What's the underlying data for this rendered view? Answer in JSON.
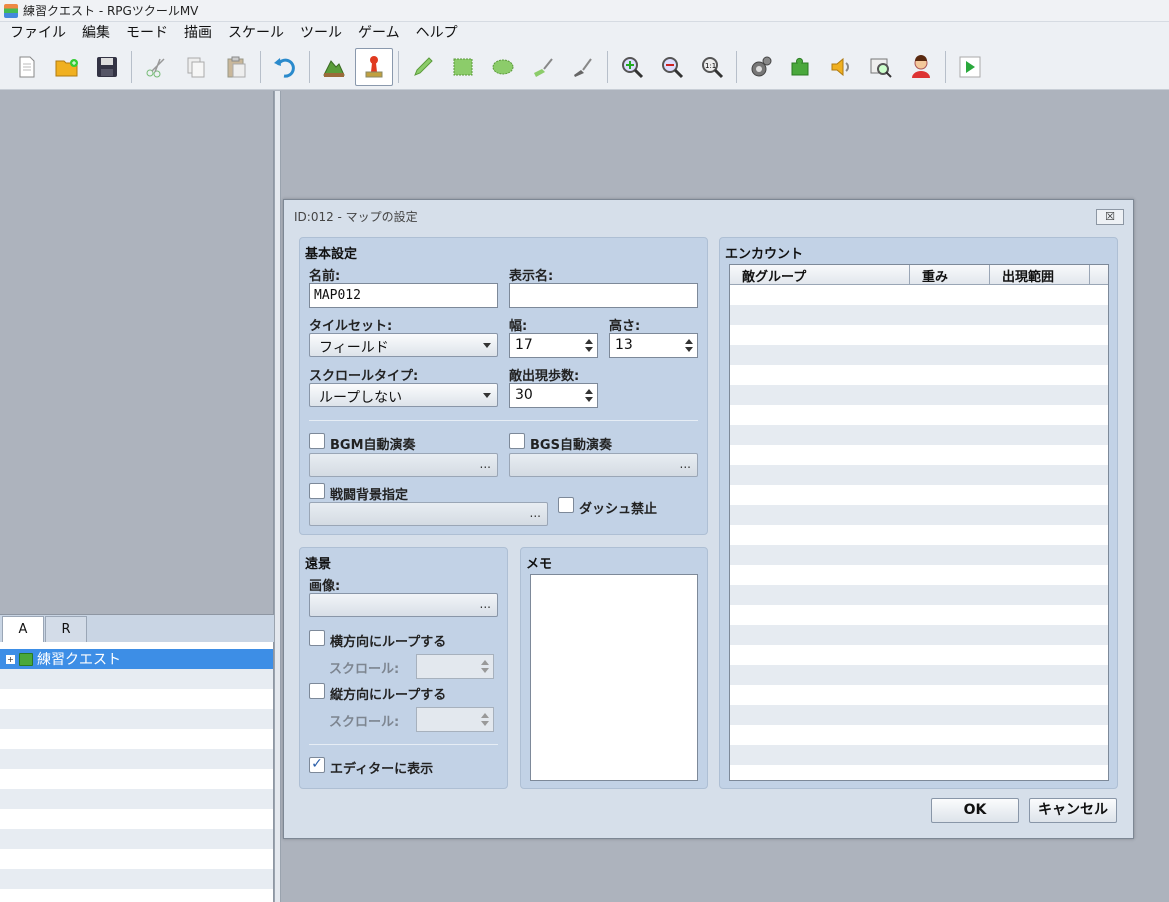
{
  "window": {
    "title": "練習クエスト - RPGツクールMV"
  },
  "menu": [
    "ファイル",
    "編集",
    "モード",
    "描画",
    "スケール",
    "ツール",
    "ゲーム",
    "ヘルプ"
  ],
  "toolbar_icons": [
    "new-project-icon",
    "open-project-icon",
    "save-icon",
    "cut-icon",
    "copy-icon",
    "paste-icon",
    "undo-icon",
    "map-mode-icon",
    "event-mode-icon",
    "pencil-icon",
    "rectangle-icon",
    "ellipse-icon",
    "fill-icon",
    "shadow-pen-icon",
    "zoom-in-icon",
    "zoom-out-icon",
    "actual-size-icon",
    "database-icon",
    "plugin-manager-icon",
    "sound-test-icon",
    "event-searcher-icon",
    "character-generator-icon",
    "playtest-icon"
  ],
  "left_panel": {
    "tabs": [
      "A",
      "R"
    ],
    "project_name": "練習クエスト"
  },
  "dialog": {
    "title": "ID:012 - マップの設定",
    "close": "☒",
    "basic": {
      "group_title": "基本設定",
      "name_label": "名前:",
      "name_value": "MAP012",
      "display_name_label": "表示名:",
      "display_name_value": "",
      "tileset_label": "タイルセット:",
      "tileset_value": "フィールド",
      "width_label": "幅:",
      "width_value": "17",
      "height_label": "高さ:",
      "height_value": "13",
      "scroll_type_label": "スクロールタイプ:",
      "scroll_type_value": "ループしない",
      "encounter_steps_label": "敵出現歩数:",
      "encounter_steps_value": "30",
      "bgm_label": "BGM自動演奏",
      "bgs_label": "BGS自動演奏",
      "battleback_label": "戦闘背景指定",
      "dash_label": "ダッシュ禁止",
      "ellipsis": "..."
    },
    "parallax": {
      "group_title": "遠景",
      "image_label": "画像:",
      "loop_h_label": "横方向にループする",
      "loop_v_label": "縦方向にループする",
      "scroll_label": "スクロール:",
      "show_in_editor_label": "エディターに表示",
      "show_in_editor_checked": "✓"
    },
    "memo": {
      "group_title": "メモ"
    },
    "encounter": {
      "group_title": "エンカウント",
      "columns": [
        "敵グループ",
        "重み",
        "出現範囲"
      ]
    },
    "ok": "OK",
    "cancel": "キャンセル"
  }
}
